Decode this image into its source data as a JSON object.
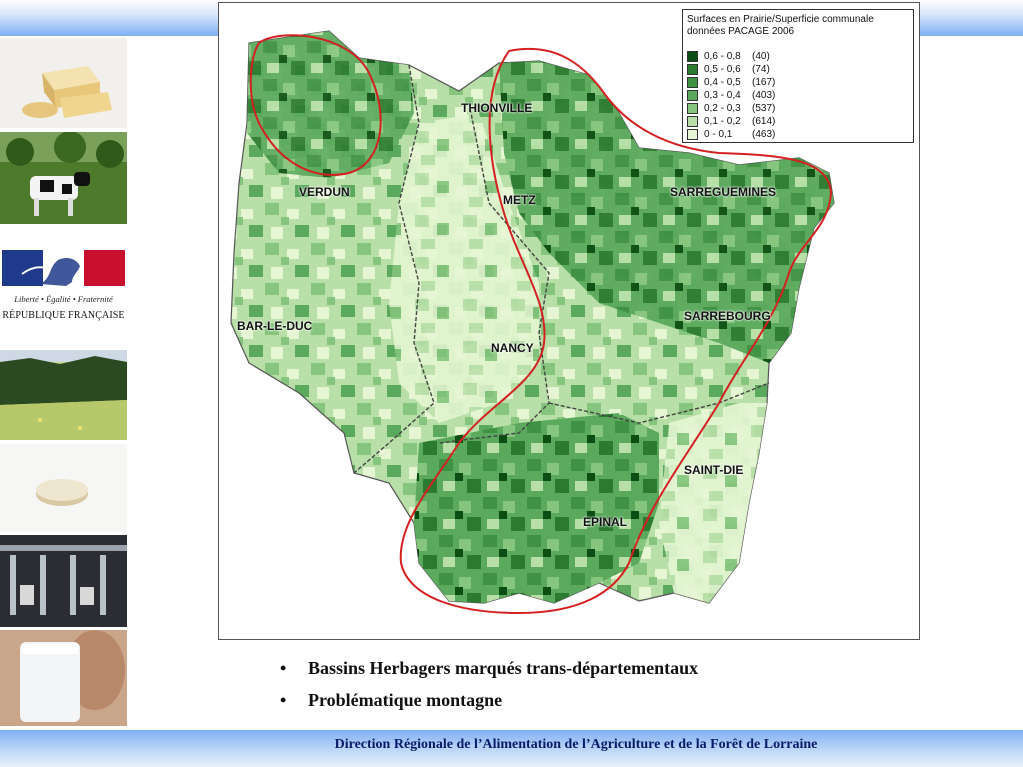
{
  "map": {
    "legend": {
      "title_line1": "Surfaces en Prairie/Superficie communale",
      "title_line2": "données PACAGE 2006",
      "classes": [
        {
          "range": "0,6 - 0,8",
          "count": "(40)",
          "color": "#0b4d12"
        },
        {
          "range": "0,5 - 0,6",
          "count": "(74)",
          "color": "#2a7a2f"
        },
        {
          "range": "0,4 - 0,5",
          "count": "(167)",
          "color": "#3f9143"
        },
        {
          "range": "0,3 - 0,4",
          "count": "(403)",
          "color": "#5aa95c"
        },
        {
          "range": "0,2 - 0,3",
          "count": "(537)",
          "color": "#86c57e"
        },
        {
          "range": "0,1 - 0,2",
          "count": "(614)",
          "color": "#b8dfa7"
        },
        {
          "range": "0   - 0,1",
          "count": "(463)",
          "color": "#e6f6d4"
        }
      ]
    },
    "cities": {
      "thionville": "THIONVILLE",
      "verdun": "VERDUN",
      "metz": "METZ",
      "sarreguemines": "SARREGUEMINES",
      "bar_le_duc": "BAR-LE-DUC",
      "sarrebourg": "SARREBOURG",
      "nancy": "NANCY",
      "saint_die": "SAINT-DIE",
      "epinal": "EPINAL"
    },
    "highlight_color": "#d42020"
  },
  "sidebar": {
    "rf_motto": "Liberté • Égalité • Fraternité",
    "rf_name": "RÉPUBLIQUE FRANÇAISE"
  },
  "bullets": [
    "Bassins Herbagers marqués trans-départementaux",
    "Problématique montagne"
  ],
  "footer": "Direction Régionale de l’Alimentation de l’Agriculture et de la Forêt de Lorraine"
}
